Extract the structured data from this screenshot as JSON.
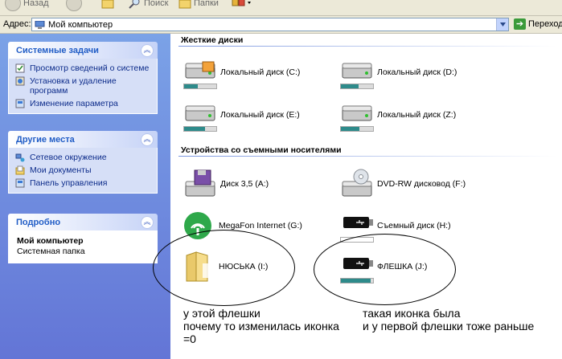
{
  "toolbar": {
    "back": "Назад",
    "search": "Поиск",
    "folders": "Папки"
  },
  "address": {
    "label": "Адрес:",
    "value": "Мой компьютер",
    "go": "Переход"
  },
  "tasks": {
    "system": {
      "title": "Системные задачи",
      "items": [
        "Просмотр сведений о системе",
        "Установка и удаление программ",
        "Изменение параметра"
      ]
    },
    "places": {
      "title": "Другие места",
      "items": [
        "Сетевое окружение",
        "Мои документы",
        "Панель управления"
      ]
    },
    "details": {
      "title": "Подробно",
      "name": "Мой компьютер",
      "desc": "Системная папка"
    }
  },
  "groups": {
    "hard": "Жесткие диски",
    "removable": "Устройства со съемными носителями"
  },
  "drives": {
    "c": {
      "label": "Локальный диск (C:)",
      "used": 0.42
    },
    "d": {
      "label": "Локальный диск (D:)",
      "used": 0.55
    },
    "e": {
      "label": "Локальный диск (E:)",
      "used": 0.65
    },
    "z": {
      "label": "Локальный диск (Z:)",
      "used": 0.58
    }
  },
  "devices": {
    "a": "Диск 3,5 (A:)",
    "f": "DVD-RW дисковод (F:)",
    "g": "MegaFon Internet (G:)",
    "h": "Съемный диск (H:)",
    "i": "НЮСЬКА (I:)",
    "j": {
      "label": "ФЛЕШКА (J:)",
      "used": 0.92
    }
  },
  "annotations": {
    "left": [
      "у этой флешки",
      "почему то изменилась иконка",
      "=0"
    ],
    "right": [
      "такая иконка была",
      "и у первой флешки тоже раньше"
    ]
  }
}
